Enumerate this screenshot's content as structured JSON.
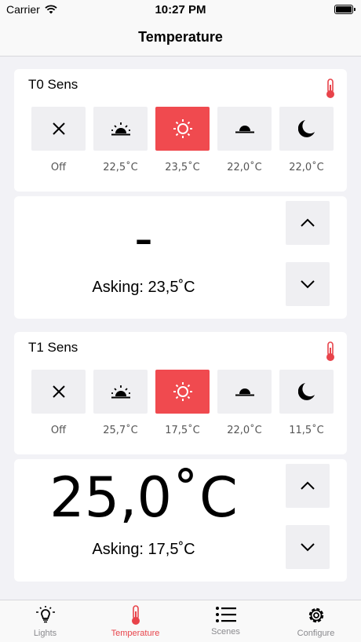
{
  "status": {
    "carrier": "Carrier",
    "time": "10:27 PM"
  },
  "nav": {
    "title": "Temperature"
  },
  "sensors": [
    {
      "name": "T0 Sens",
      "modes": [
        {
          "icon": "close-icon",
          "value": "Off",
          "active": false
        },
        {
          "icon": "sunrise-icon",
          "value": "22,5˚C",
          "active": false
        },
        {
          "icon": "sun-icon",
          "value": "23,5˚C",
          "active": true
        },
        {
          "icon": "sunset-icon",
          "value": "22,0˚C",
          "active": false
        },
        {
          "icon": "moon-icon",
          "value": "22,0˚C",
          "active": false
        }
      ],
      "current": "–",
      "asking": "Asking: 23,5˚C"
    },
    {
      "name": "T1 Sens",
      "modes": [
        {
          "icon": "close-icon",
          "value": "Off",
          "active": false
        },
        {
          "icon": "sunrise-icon",
          "value": "25,7˚C",
          "active": false
        },
        {
          "icon": "sun-icon",
          "value": "17,5˚C",
          "active": true
        },
        {
          "icon": "sunset-icon",
          "value": "22,0˚C",
          "active": false
        },
        {
          "icon": "moon-icon",
          "value": "11,5˚C",
          "active": false
        }
      ],
      "current": "25,0˚C",
      "asking": "Asking: 17,5˚C"
    }
  ],
  "tabs": [
    {
      "label": "Lights",
      "icon": "bulb-icon",
      "active": false
    },
    {
      "label": "Temperature",
      "icon": "thermometer-icon",
      "active": true
    },
    {
      "label": "Scenes",
      "icon": "list-icon",
      "active": false
    },
    {
      "label": "Configure",
      "icon": "gear-icon",
      "active": false
    }
  ],
  "colors": {
    "accent": "#f04a4f",
    "background": "#f2f2f6",
    "button": "#efeff2"
  }
}
